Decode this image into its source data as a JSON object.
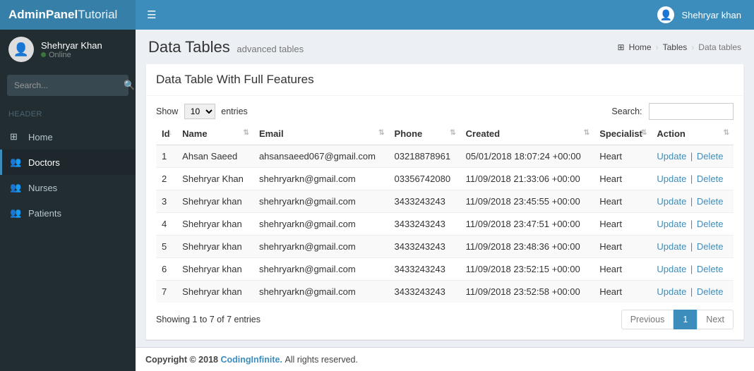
{
  "brand": {
    "bold": "AdminPanel",
    "light": "Tutorial"
  },
  "header_user": "Shehryar khan",
  "sidebar": {
    "user": {
      "name": "Shehryar Khan",
      "status": "Online"
    },
    "search_placeholder": "Search...",
    "section_label": "HEADER",
    "items": [
      {
        "label": "Home"
      },
      {
        "label": "Doctors"
      },
      {
        "label": "Nurses"
      },
      {
        "label": "Patients"
      }
    ]
  },
  "page": {
    "title": "Data Tables",
    "subtitle": "advanced tables",
    "breadcrumb": {
      "home": "Home",
      "mid": "Tables",
      "current": "Data tables"
    }
  },
  "box": {
    "title": "Data Table With Full Features",
    "length_prefix": "Show",
    "length_value": "10",
    "length_suffix": "entries",
    "search_label": "Search:",
    "columns": [
      "Id",
      "Name",
      "Email",
      "Phone",
      "Created",
      "Specialist",
      "Action"
    ],
    "rows": [
      {
        "id": "1",
        "name": "Ahsan Saeed",
        "email": "ahsansaeed067@gmail.com",
        "phone": "03218878961",
        "created": "05/01/2018 18:07:24 +00:00",
        "specialist": "Heart"
      },
      {
        "id": "2",
        "name": "Shehryar Khan",
        "email": "shehryarkn@gmail.com",
        "phone": "03356742080",
        "created": "11/09/2018 21:33:06 +00:00",
        "specialist": "Heart"
      },
      {
        "id": "3",
        "name": "Shehryar khan",
        "email": "shehryarkn@gmail.com",
        "phone": "3433243243",
        "created": "11/09/2018 23:45:55 +00:00",
        "specialist": "Heart"
      },
      {
        "id": "4",
        "name": "Shehryar khan",
        "email": "shehryarkn@gmail.com",
        "phone": "3433243243",
        "created": "11/09/2018 23:47:51 +00:00",
        "specialist": "Heart"
      },
      {
        "id": "5",
        "name": "Shehryar khan",
        "email": "shehryarkn@gmail.com",
        "phone": "3433243243",
        "created": "11/09/2018 23:48:36 +00:00",
        "specialist": "Heart"
      },
      {
        "id": "6",
        "name": "Shehryar khan",
        "email": "shehryarkn@gmail.com",
        "phone": "3433243243",
        "created": "11/09/2018 23:52:15 +00:00",
        "specialist": "Heart"
      },
      {
        "id": "7",
        "name": "Shehryar khan",
        "email": "shehryarkn@gmail.com",
        "phone": "3433243243",
        "created": "11/09/2018 23:52:58 +00:00",
        "specialist": "Heart"
      }
    ],
    "action_update": "Update",
    "action_delete": "Delete",
    "info": "Showing 1 to 7 of 7 entries",
    "pagination": {
      "prev": "Previous",
      "page": "1",
      "next": "Next"
    }
  },
  "footer": {
    "prefix": "Copyright © 2018 ",
    "link": "CodingInfinite.",
    "suffix": " All rights reserved."
  }
}
